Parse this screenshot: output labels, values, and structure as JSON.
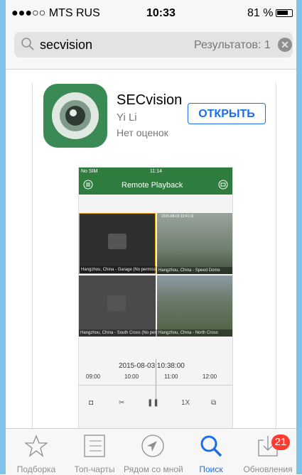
{
  "status_bar": {
    "carrier": "●●●○○ MTS RUS",
    "time": "10:33",
    "battery": "81 %"
  },
  "search": {
    "query": "secvision",
    "results": "Результатов: 1"
  },
  "app": {
    "name": "SECvision",
    "developer": "Yi Li",
    "rating": "Нет оценок",
    "open_label": "ОТКРЫТЬ",
    "icon_color": "#3a8a55"
  },
  "preview": {
    "status_left": "No SIM",
    "status_time": "11:14",
    "nav_title": "Remote Playback",
    "tiles": [
      {
        "caption": "Hangzhou, China - Garage (No permission)",
        "stamp": ""
      },
      {
        "caption": "Hangzhou, China - Speed Dome",
        "stamp": "2015-08-03 10:41:11"
      },
      {
        "caption": "Hangzhou, China - South Cross (No permission)",
        "stamp": ""
      },
      {
        "caption": "Hangzhou, China - North Cross",
        "stamp": ""
      }
    ],
    "datetime": "2015-08-03  10:38:00",
    "ticks": [
      "09:00",
      "10:00",
      "11:00",
      "12:00"
    ],
    "speed": "1X"
  },
  "tabs": [
    {
      "label": "Подборка",
      "icon": "star-icon"
    },
    {
      "label": "Топ-чарты",
      "icon": "list-icon"
    },
    {
      "label": "Рядом со мной",
      "icon": "location-icon"
    },
    {
      "label": "Поиск",
      "icon": "search-icon",
      "active": true
    },
    {
      "label": "Обновления",
      "icon": "download-icon",
      "badge": "21"
    }
  ],
  "colors": {
    "accent": "#1b6ee8",
    "badge": "#ff3b30",
    "edge": "#7ec3ea"
  }
}
